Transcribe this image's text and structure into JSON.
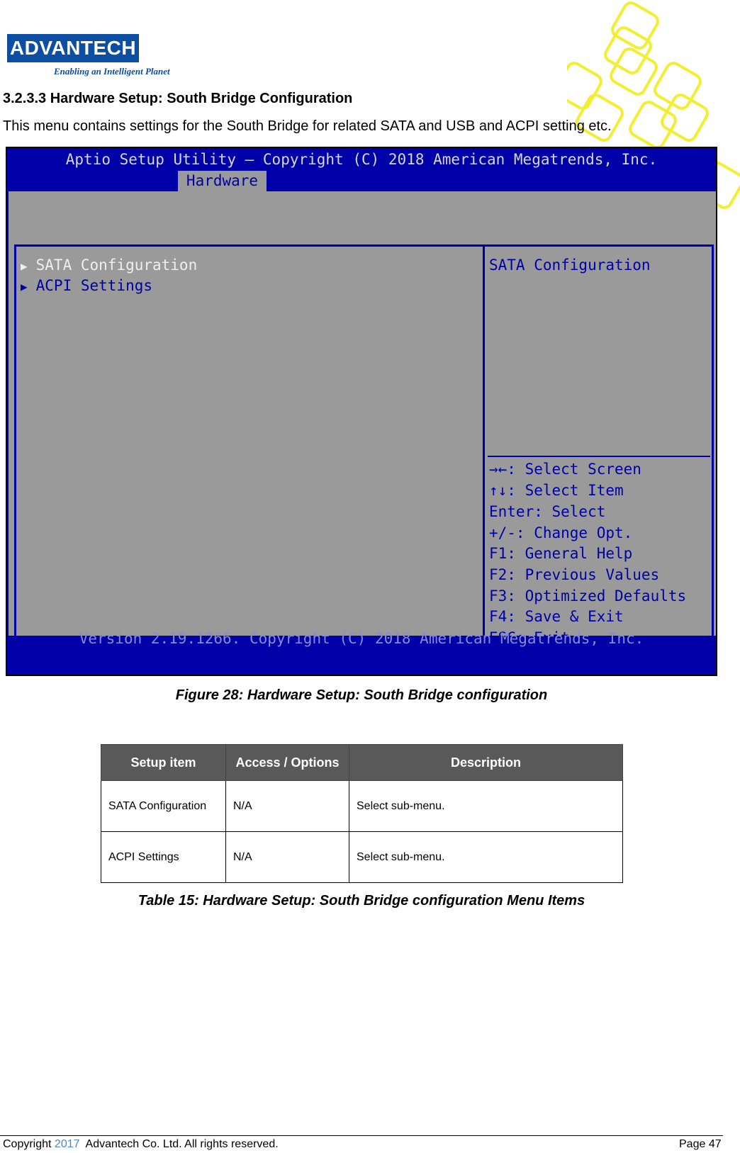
{
  "logo": {
    "text": "ADVANTECH",
    "tagline": "Enabling an Intelligent Planet"
  },
  "heading": "3.2.3.3  Hardware Setup: South Bridge Configuration",
  "intro": "This menu contains settings for the South Bridge for related SATA and USB and ACPI setting etc.",
  "bios": {
    "title": "Aptio Setup Utility – Copyright (C) 2018 American Megatrends, Inc.",
    "tab": "Hardware",
    "menu": [
      {
        "label": "SATA Configuration",
        "selected": true
      },
      {
        "label": "ACPI Settings",
        "selected": false
      }
    ],
    "help_title": "SATA Configuration",
    "keys": [
      "→←: Select Screen",
      "↑↓: Select Item",
      "Enter: Select",
      "+/-: Change Opt.",
      "F1: General Help",
      "F2: Previous Values",
      "F3: Optimized Defaults",
      "F4: Save & Exit",
      "ESC: Exit"
    ],
    "footer": "Version 2.19.1266. Copyright (C) 2018 American Megatrends, Inc.",
    "colors": {
      "background": "#0000a8",
      "panel": "#9a9a9a",
      "selected_text": "#eeeeee"
    }
  },
  "figure_caption": "Figure 28: Hardware Setup: South Bridge configuration",
  "table": {
    "headers": [
      "Setup item",
      "Access / Options",
      "Description"
    ],
    "rows": [
      [
        "SATA Configuration",
        "N/A",
        "Select sub-menu."
      ],
      [
        "ACPI Settings",
        "N/A",
        "Select sub-menu."
      ]
    ]
  },
  "table_caption": "Table 15: Hardware Setup: South Bridge configuration Menu Items",
  "footer": {
    "prefix": "Copyright ",
    "year": "2017",
    "suffix": "  Advantech Co. Ltd. All rights reserved.",
    "page": "Page 47"
  }
}
